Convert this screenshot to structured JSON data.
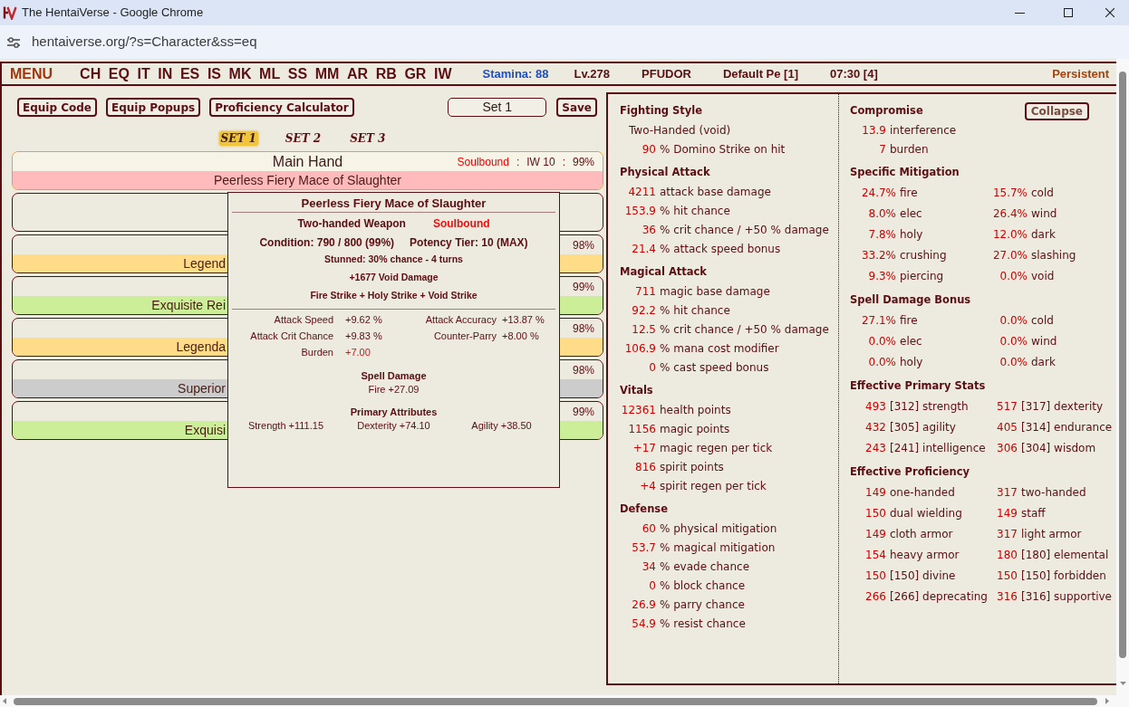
{
  "browser": {
    "title": "The HentaiVerse - Google Chrome",
    "url": "hentaiverse.org/?s=Character&ss=eq"
  },
  "menu_bar": {
    "menu": "MENU",
    "links": [
      "CH",
      "EQ",
      "IT",
      "IN",
      "ES",
      "IS",
      "MK",
      "ML",
      "SS",
      "MM",
      "AR",
      "RB",
      "GR",
      "IW"
    ],
    "stamina": "Stamina: 88",
    "info": [
      "Lv.278",
      "PFUDOR",
      "Default Pe [1]",
      "07:30 [4]"
    ],
    "mode": "Persistent"
  },
  "equipment": {
    "buttons": [
      "Equip Code",
      "Equip Popups",
      "Proficiency Calculator"
    ],
    "set_name": {
      "value": "Set 1"
    },
    "save_button": "Save",
    "set_tabs": [
      {
        "label": "SET 1",
        "selected": true
      },
      {
        "label": "SET 2",
        "selected": false
      },
      {
        "label": "SET 3",
        "selected": false
      }
    ],
    "slots": [
      {
        "name": "Main Hand",
        "hovered": true,
        "details": [
          {
            "kind": "binding",
            "text": "Soulbound"
          },
          {
            "kind": "text",
            "text": ":"
          },
          {
            "kind": "text",
            "text": "IW 10"
          },
          {
            "kind": "text",
            "text": ":"
          },
          {
            "kind": "text",
            "text": "99%"
          }
        ],
        "item": {
          "name": "Peerless Fiery Mace of Slaughter",
          "color": "#ffbbbb"
        }
      },
      {
        "hovered": false
      },
      {
        "hovered": false,
        "details": [
          {
            "kind": "text",
            "text": "98%"
          }
        ],
        "item": {
          "name": "Legend",
          "color": "#ffdd88"
        }
      },
      {
        "hovered": false,
        "details": [
          {
            "kind": "text",
            "text": "99%"
          }
        ],
        "item": {
          "name": "Exquisite Rei",
          "color": "#ccee99"
        }
      },
      {
        "hovered": false,
        "details": [
          {
            "kind": "text",
            "text": "98%"
          }
        ],
        "item": {
          "name": "Legenda",
          "color": "#ffdd88"
        }
      },
      {
        "hovered": false,
        "details": [
          {
            "kind": "text",
            "text": "98%"
          }
        ],
        "item": {
          "name": "Superior",
          "color": "#cccccc"
        }
      },
      {
        "hovered": false,
        "details": [
          {
            "kind": "text",
            "text": "99%"
          }
        ],
        "item": {
          "name": "Exquisi",
          "color": "#ccee99"
        }
      }
    ],
    "tooltip": {
      "title": "Peerless Fiery Mace of Slaughter",
      "type": "Two-handed Weapon",
      "binding": "Soulbound",
      "condition": "Condition: 790 / 800 (99%)",
      "potency": "Potency Tier: 10 (MAX)",
      "effects": [
        "Stunned: 30% chance - 4 turns",
        "+1677 Void Damage",
        "Fire Strike + Holy Strike + Void Strike"
      ],
      "stats": [
        {
          "label": "Attack Speed",
          "value": "+9.62 %",
          "penalty": false
        },
        {
          "label": "Attack Accuracy",
          "value": "+13.87 %",
          "penalty": false
        },
        {
          "label": "Attack Crit Chance",
          "value": "+9.83 %",
          "penalty": false
        },
        {
          "label": "Counter-Parry",
          "value": "+8.00 %",
          "penalty": false
        },
        {
          "label": "Burden",
          "value": "+7.00",
          "penalty": true
        }
      ],
      "sections": [
        {
          "title": "Spell Damage",
          "entries": [
            "Fire +27.09"
          ]
        },
        {
          "title": "Primary Attributes",
          "entries": [
            "Strength +111.15",
            "Dexterity +74.10",
            "Agility +38.50"
          ]
        }
      ]
    }
  },
  "stat_panel": {
    "columns": [
      [
        {
          "title": "Fighting Style",
          "kind": "list",
          "rows": [
            {
              "kind": "note",
              "text": "Two-Handed (void)"
            },
            {
              "kind": "stat",
              "amount": "90",
              "stat": "% Domino Strike on hit"
            }
          ]
        },
        {
          "title": "Physical Attack",
          "kind": "list",
          "rows": [
            {
              "amount": "4211",
              "stat": "attack base damage"
            },
            {
              "amount": "153.9",
              "stat": "% hit chance"
            },
            {
              "amount": "36",
              "stat": "% crit chance / +50 % damage"
            },
            {
              "amount": "21.4",
              "stat": "% attack speed bonus"
            }
          ]
        },
        {
          "title": "Magical Attack",
          "kind": "list",
          "rows": [
            {
              "amount": "711",
              "stat": "magic base damage"
            },
            {
              "amount": "92.2",
              "stat": "% hit chance"
            },
            {
              "amount": "12.5",
              "stat": "% crit chance / +50 % damage"
            },
            {
              "amount": "106.9",
              "stat": "% mana cost modifier"
            },
            {
              "amount": "0",
              "stat": "% cast speed bonus"
            }
          ]
        },
        {
          "title": "Vitals",
          "kind": "list",
          "rows": [
            {
              "amount": "12361",
              "stat": "health points"
            },
            {
              "amount": "1156",
              "stat": "magic points"
            },
            {
              "amount": "+17",
              "stat": "magic regen per tick"
            },
            {
              "amount": "816",
              "stat": "spirit points"
            },
            {
              "amount": "+4",
              "stat": "spirit regen per tick"
            }
          ]
        },
        {
          "title": "Defense",
          "kind": "list",
          "rows": [
            {
              "amount": "60",
              "stat": "% physical mitigation"
            },
            {
              "amount": "53.7",
              "stat": "% magical mitigation"
            },
            {
              "amount": "34",
              "stat": "% evade chance"
            },
            {
              "amount": "0",
              "stat": "% block chance"
            },
            {
              "amount": "26.9",
              "stat": "% parry chance"
            },
            {
              "amount": "54.9",
              "stat": "% resist chance"
            }
          ]
        }
      ],
      [
        {
          "title": "Compromise",
          "kind": "list",
          "button": "Collapse",
          "rows": [
            {
              "amount": "13.9",
              "stat": "interference"
            },
            {
              "amount": "7",
              "stat": "burden"
            }
          ]
        },
        {
          "title": "Specific Mitigation",
          "kind": "pctgrid",
          "cells": [
            {
              "amount": "24.7%",
              "stat": "fire"
            },
            {
              "amount": "15.7%",
              "stat": "cold"
            },
            {
              "amount": "8.0%",
              "stat": "elec"
            },
            {
              "amount": "26.4%",
              "stat": "wind"
            },
            {
              "amount": "7.8%",
              "stat": "holy"
            },
            {
              "amount": "12.0%",
              "stat": "dark"
            },
            {
              "amount": "33.2%",
              "stat": "crushing"
            },
            {
              "amount": "27.0%",
              "stat": "slashing"
            },
            {
              "amount": "9.3%",
              "stat": "piercing"
            },
            {
              "amount": "0.0%",
              "stat": "void"
            }
          ]
        },
        {
          "title": "Spell Damage Bonus",
          "kind": "pctgrid",
          "cells": [
            {
              "amount": "27.1%",
              "stat": "fire"
            },
            {
              "amount": "0.0%",
              "stat": "cold"
            },
            {
              "amount": "0.0%",
              "stat": "elec"
            },
            {
              "amount": "0.0%",
              "stat": "wind"
            },
            {
              "amount": "0.0%",
              "stat": "holy"
            },
            {
              "amount": "0.0%",
              "stat": "dark"
            }
          ]
        },
        {
          "title": "Effective Primary Stats",
          "kind": "grid",
          "cells": [
            {
              "amount": "493",
              "stat": "[312] strength"
            },
            {
              "amount": "517",
              "stat": "[317] dexterity"
            },
            {
              "amount": "432",
              "stat": "[305] agility"
            },
            {
              "amount": "405",
              "stat": "[314] endurance"
            },
            {
              "amount": "243",
              "stat": "[241] intelligence"
            },
            {
              "amount": "306",
              "stat": "[304] wisdom"
            }
          ]
        },
        {
          "title": "Effective Proficiency",
          "kind": "grid",
          "cells": [
            {
              "amount": "149",
              "stat": "one-handed"
            },
            {
              "amount": "317",
              "stat": "two-handed"
            },
            {
              "amount": "150",
              "stat": "dual wielding"
            },
            {
              "amount": "149",
              "stat": "staff"
            },
            {
              "amount": "149",
              "stat": "cloth armor"
            },
            {
              "amount": "317",
              "stat": "light armor"
            },
            {
              "amount": "154",
              "stat": "heavy armor"
            },
            {
              "amount": "180",
              "stat": "[180] elemental"
            },
            {
              "amount": "150",
              "stat": "[150] divine"
            },
            {
              "amount": "150",
              "stat": "[150] forbidden"
            },
            {
              "amount": "266",
              "stat": "[266] deprecating"
            },
            {
              "amount": "316",
              "stat": "[316] supportive"
            }
          ]
        }
      ]
    ]
  }
}
